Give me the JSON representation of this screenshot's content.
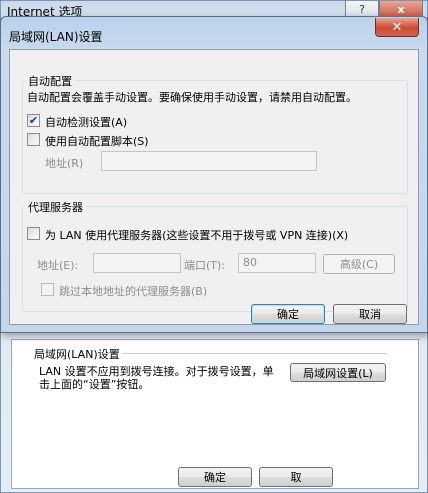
{
  "background_window": {
    "title": "Internet 选项",
    "help_button": "?",
    "close_button": "x",
    "lan_group": {
      "title": "局域网(LAN)设置",
      "description": "LAN 设置不应用到拨号连接。对于拨号设置，单击上面的“设置”按钮。",
      "lan_settings_button": "局域网设置(L)"
    },
    "ok_button": "确定",
    "cancel_button": "取"
  },
  "dialog": {
    "title": "局域网(LAN)设置",
    "close_glyph": "✕",
    "auto_config": {
      "group_title": "自动配置",
      "description": "自动配置会覆盖手动设置。要确保使用手动设置，请禁用自动配置。",
      "auto_detect": {
        "label": "自动检测设置(A)",
        "checked": true
      },
      "use_script": {
        "label": "使用自动配置脚本(S)",
        "checked": false
      },
      "address_label": "地址(R)",
      "address_value": ""
    },
    "proxy": {
      "group_title": "代理服务器",
      "use_proxy": {
        "label": "为 LAN 使用代理服务器(这些设置不用于拨号或 VPN 连接)(X)",
        "checked": false
      },
      "address_label": "地址(E):",
      "address_value": "",
      "port_label": "端口(T):",
      "port_value": "80",
      "advanced_button": "高级(C)",
      "bypass_local": {
        "label": "跳过本地地址的代理服务器(B)",
        "checked": false
      }
    },
    "ok_button": "确定",
    "cancel_button": "取消"
  }
}
